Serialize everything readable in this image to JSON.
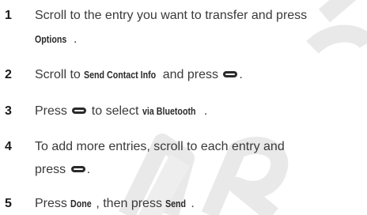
{
  "steps": [
    {
      "number": "1",
      "line1_text": "Scroll to the entry you want to transfer and press",
      "line2_keyword": "Options",
      "line2_tail": "."
    },
    {
      "number": "2",
      "pre": "Scroll to ",
      "keyword": "Send Contact Info",
      "mid": " and press",
      "post": "."
    },
    {
      "number": "3",
      "pre": "Press",
      "mid": " to select ",
      "keyword": "via Bluetooth",
      "post": "."
    },
    {
      "number": "4",
      "line1_text": "To add more entries, scroll to each entry and",
      "line2_pre": "press",
      "line2_post": "."
    },
    {
      "number": "5",
      "pre": "Press ",
      "keyword1": "Done",
      "mid": ", then press ",
      "keyword2": "Send",
      "post": "."
    }
  ],
  "icons": {
    "select_key": "center-select-key-icon"
  },
  "colors": {
    "text": "#3a3a3a",
    "number": "#1a1a1a",
    "watermark": "#e6e6e6"
  }
}
